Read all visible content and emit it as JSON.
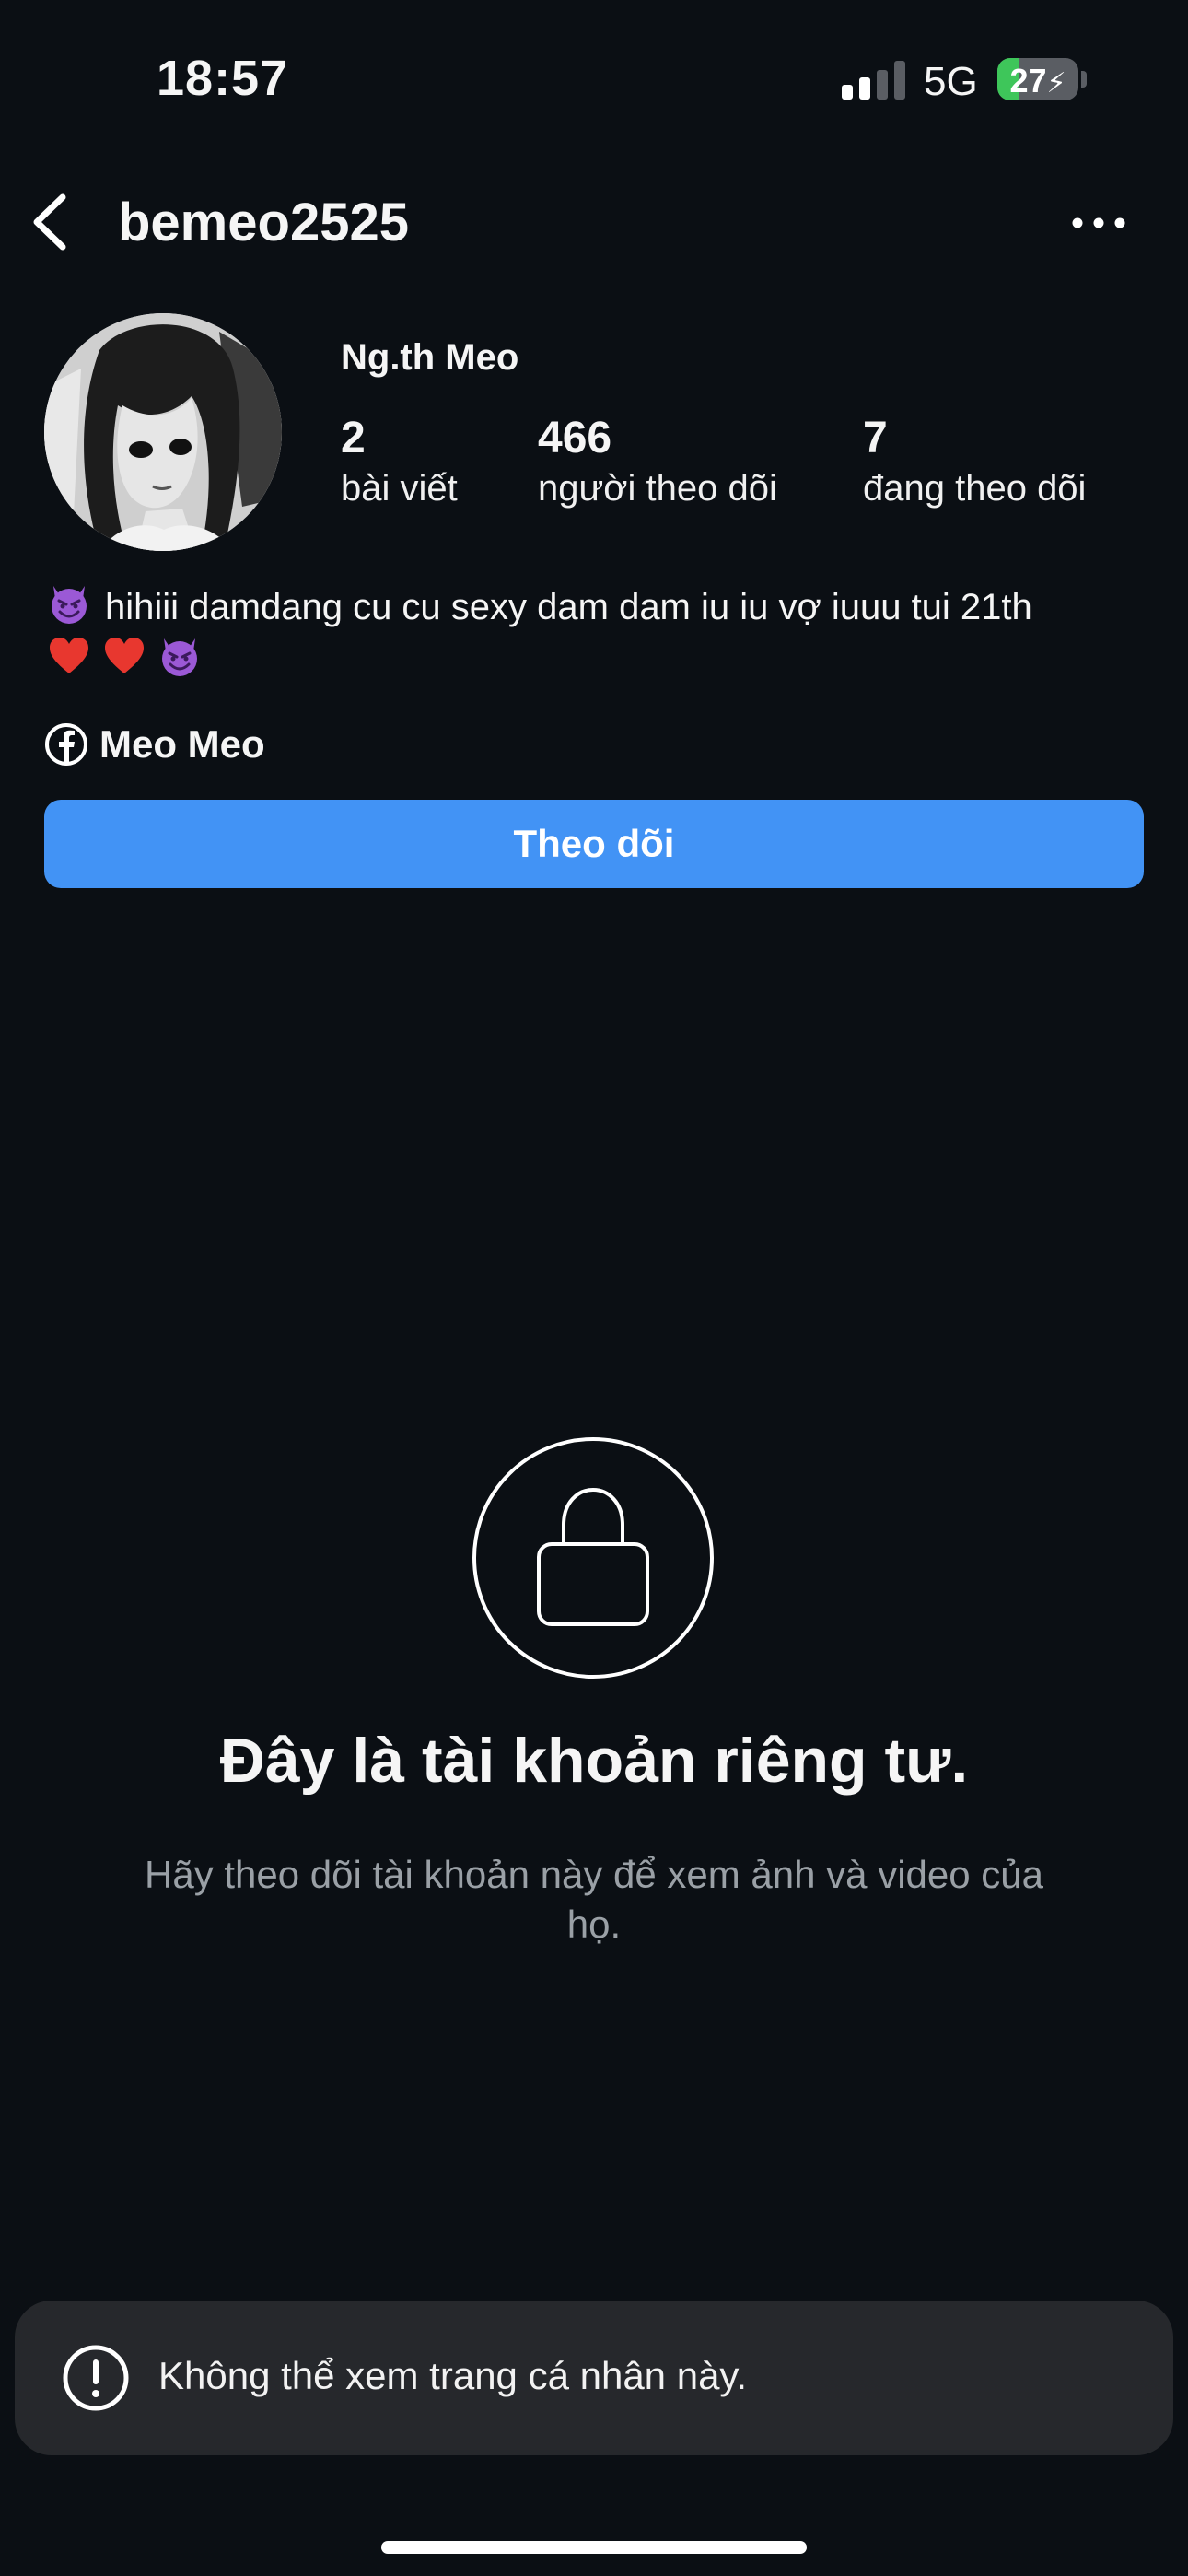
{
  "status_bar": {
    "time": "18:57",
    "network": "5G",
    "battery_percent": "27",
    "battery_level": 0.27,
    "signal_bars_active": 2,
    "signal_bars_total": 4
  },
  "header": {
    "username": "bemeo2525",
    "back_icon": "chevron-left-icon",
    "more_icon": "more-horizontal-icon"
  },
  "profile": {
    "display_name": "Ng.th Meo",
    "stats": [
      {
        "value": "2",
        "label": "bài viết"
      },
      {
        "value": "466",
        "label": "người theo dõi"
      },
      {
        "value": "7",
        "label": "đang theo dõi"
      }
    ],
    "bio_line1": "hihiii damdang cu cu sexy dam dam iu iu vợ iuuu tui 21th",
    "bio_emojis_line1": [
      "devil-emoji"
    ],
    "bio_emojis_line2": [
      "heart-emoji",
      "heart-emoji",
      "devil-emoji"
    ],
    "link_icon": "facebook-icon",
    "link_text": "Meo Meo",
    "follow_button": "Theo dõi"
  },
  "private_notice": {
    "icon": "lock-icon",
    "title": "Đây là tài khoản riêng tư.",
    "description": "Hãy theo dõi tài khoản này để xem ảnh và video của họ."
  },
  "toast": {
    "icon": "alert-circle-icon",
    "message": "Không thể xem trang cá nhân này."
  },
  "colors": {
    "background": "#0b0f14",
    "accent": "#4293f5",
    "battery_fill": "#3ec65a",
    "toast_bg": "#26282c",
    "muted_text": "#9aa0a6"
  }
}
